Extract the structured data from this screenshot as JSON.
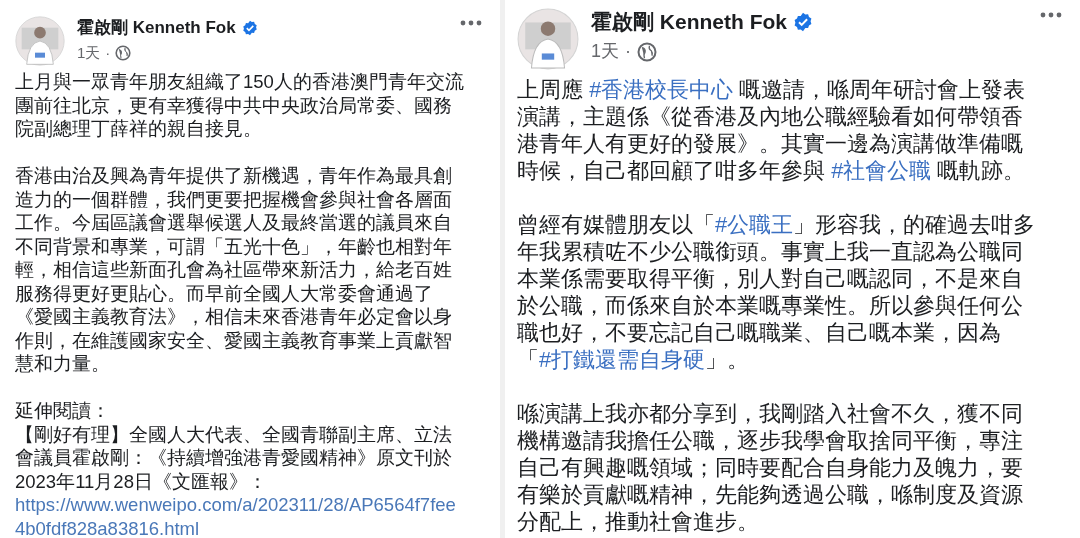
{
  "posts": [
    {
      "author": "霍啟剛 Kenneth Fok",
      "verified": true,
      "time": "1天",
      "separator": "·",
      "paragraphs": [
        {
          "blocks": [
            {
              "kind": "text",
              "segments": [
                {
                  "kind": "plain",
                  "text": "上月與一眾青年朋友組織了150人的香港澳門青年交流團前往北京，更有幸獲得中共中央政治局常委、國務院副總理丁薛祥的親自接見。"
                }
              ]
            }
          ]
        },
        {
          "blocks": [
            {
              "kind": "text",
              "segments": [
                {
                  "kind": "plain",
                  "text": "香港由治及興為青年提供了新機遇，青年作為最具創造力的一個群體，我們更要把握機會參與社會各層面工作。今屆區議會選舉候選人及最終當選的議員來自不同背景和專業，可謂「五光十色」，年齡也相對年輕，相信這些新面孔會為社區帶來新活力，給老百姓服務得更好更貼心。而早前全國人大常委會通過了《愛國主義教育法》，相信未來香港青年必定會以身作則，在維護國家安全、愛國主義教育事業上貢獻智慧和力量。"
                }
              ]
            }
          ]
        },
        {
          "blocks": [
            {
              "kind": "text",
              "segments": [
                {
                  "kind": "plain",
                  "text": "延伸閱讀："
                }
              ]
            },
            {
              "kind": "text",
              "segments": [
                {
                  "kind": "plain",
                  "text": "【剛好有理】全國人大代表、全國青聯副主席、立法會議員霍啟剛：《持續增強港青愛國精神》原文刊於2023年11月28日《文匯報》："
                }
              ]
            },
            {
              "kind": "link",
              "text": "https://www.wenweipo.com/a/202311/28/AP6564f7fee4b0fdf828a83816.html"
            }
          ]
        }
      ]
    },
    {
      "author": "霍啟剛 Kenneth Fok",
      "verified": true,
      "time": "1天",
      "separator": "·",
      "paragraphs": [
        {
          "blocks": [
            {
              "kind": "text",
              "segments": [
                {
                  "kind": "plain",
                  "text": "上周應 "
                },
                {
                  "kind": "hashtag",
                  "text": "#香港校長中心"
                },
                {
                  "kind": "plain",
                  "text": " 嘅邀請，喺周年研討會上發表演講，主題係《從香港及內地公職經驗看如何帶領香港青年人有更好的發展》。其實一邊為演講做準備嘅時候，自己都回顧了咁多年參與 "
                },
                {
                  "kind": "hashtag",
                  "text": "#社會公職"
                },
                {
                  "kind": "plain",
                  "text": " 嘅軌跡。"
                }
              ]
            }
          ]
        },
        {
          "blocks": [
            {
              "kind": "text",
              "segments": [
                {
                  "kind": "plain",
                  "text": "曾經有媒體朋友以「"
                },
                {
                  "kind": "hashtag",
                  "text": "#公職王"
                },
                {
                  "kind": "plain",
                  "text": "」形容我，的確過去咁多年我累積咗不少公職銜頭。事實上我一直認為公職同本業係需要取得平衡，別人對自己嘅認同，不是來自於公職，而係來自於本業嘅專業性。所以參與任何公職也好，不要忘記自己嘅職業、自己嘅本業，因為「"
                },
                {
                  "kind": "hashtag",
                  "text": "#打鐵還需自身硬"
                },
                {
                  "kind": "plain",
                  "text": "」。"
                }
              ]
            }
          ]
        },
        {
          "blocks": [
            {
              "kind": "text",
              "segments": [
                {
                  "kind": "plain",
                  "text": "喺演講上我亦都分享到，我剛踏入社會不久，獲不同機構邀請我擔任公職，逐步我學會取捨同平衡，專注自己有興趣嘅領域；同時要配合自身能力及魄力，要有樂於貢獻嘅精神，先能夠透過公職，喺制度及資源分配上，推動社會進步。"
                }
              ]
            }
          ]
        }
      ]
    }
  ]
}
